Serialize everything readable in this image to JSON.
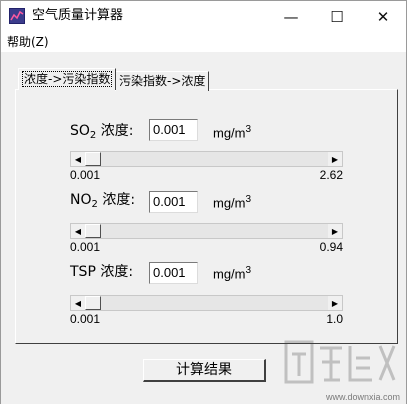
{
  "window": {
    "title": "空气质量计算器"
  },
  "title_buttons": {
    "minimize": "—",
    "maximize": "☐",
    "close": "✕"
  },
  "menu": {
    "help": "帮助(Z)"
  },
  "tabs": [
    {
      "label": "浓度->污染指数",
      "active": true
    },
    {
      "label": "污染指数->浓度",
      "active": false
    }
  ],
  "rows": [
    {
      "name": "SO",
      "sub": "2",
      "suffix": " 浓度:",
      "value": "0.001",
      "unit": "mg/m",
      "unit_exp": "3",
      "min": "0.001",
      "max": "2.62",
      "level": 0.0
    },
    {
      "name": "NO",
      "sub": "2",
      "suffix": " 浓度:",
      "value": "0.001",
      "unit": "mg/m",
      "unit_exp": "3",
      "min": "0.001",
      "max": "0.94",
      "level": 0.0
    },
    {
      "name": "TSP",
      "sub": "",
      "suffix": " 浓度:",
      "value": "0.001",
      "unit": "mg/m",
      "unit_exp": "3",
      "min": "0.001",
      "max": "1.0",
      "level": 0.0
    }
  ],
  "calculate_button": "计算结果",
  "watermark": {
    "text": "www.downxia.com"
  },
  "colors": {
    "title_bg": "#ffffff",
    "client_bg": "#f0f0f0",
    "scroll_track": "#e6e6e6"
  }
}
